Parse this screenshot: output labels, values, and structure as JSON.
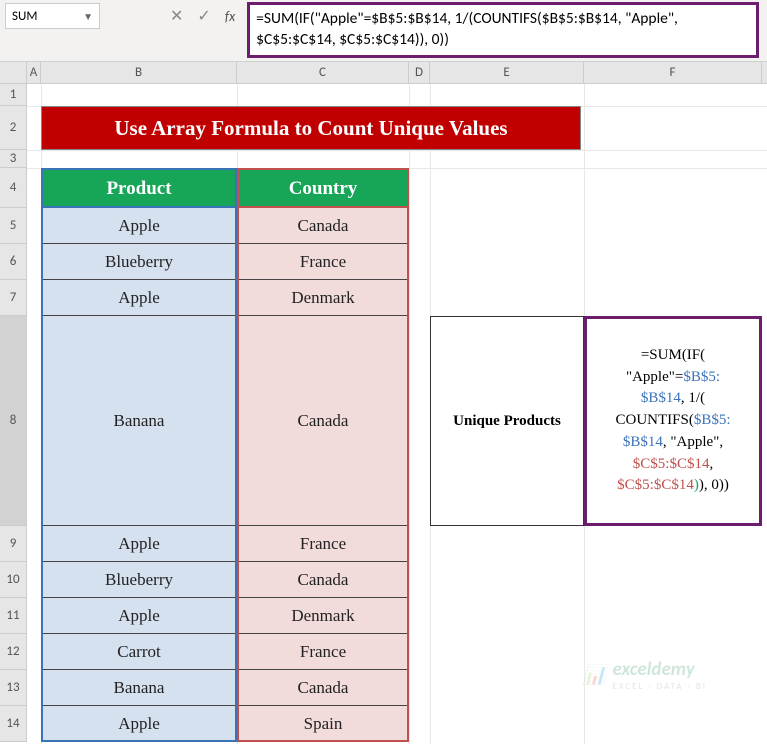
{
  "namebox": {
    "value": "SUM"
  },
  "formula_bar": "=SUM(IF(\"Apple\"=$B$5:$B$14, 1/(COUNTIFS($B$5:$B$14, \"Apple\", $C$5:$C$14, $C$5:$C$14)), 0))",
  "columns": [
    "A",
    "B",
    "C",
    "D",
    "E",
    "F"
  ],
  "rows": [
    "1",
    "2",
    "3",
    "4",
    "5",
    "6",
    "7",
    "8",
    "9",
    "10",
    "11",
    "12",
    "13",
    "14"
  ],
  "title": "Use Array Formula to Count Unique Values",
  "headers": {
    "product": "Product",
    "country": "Country"
  },
  "data": {
    "products": [
      "Apple",
      "Blueberry",
      "Apple",
      "Banana",
      "Apple",
      "Blueberry",
      "Apple",
      "Carrot",
      "Banana",
      "Apple"
    ],
    "countries": [
      "Canada",
      "France",
      "Denmark",
      "Canada",
      "France",
      "Canada",
      "Denmark",
      "France",
      "Canada",
      "Spain"
    ]
  },
  "side": {
    "label": "Unique Products",
    "formula_parts": {
      "p1": "=SUM(IF(",
      "p2": "\"Apple\"=",
      "p3": "$B$5:",
      "p4": "$B$14",
      "p5": ", 1/(",
      "p6": "COUNTIFS(",
      "p7": "$B$5:",
      "p8": "$B$14",
      "p9": ", \"Apple\",",
      "p10": "$C$5:$C$14",
      "p11": ",",
      "p12": "$C$5:$C$14",
      "p13": ")",
      "p14": ")",
      "p15": ", 0)",
      "p16": ")"
    }
  },
  "watermark": {
    "brand": "exceldemy",
    "tag": "EXCEL · DATA · BI"
  },
  "chart_data": {
    "type": "table",
    "title": "Use Array Formula to Count Unique Values",
    "columns": [
      "Product",
      "Country"
    ],
    "rows": [
      [
        "Apple",
        "Canada"
      ],
      [
        "Blueberry",
        "France"
      ],
      [
        "Apple",
        "Denmark"
      ],
      [
        "Banana",
        "Canada"
      ],
      [
        "Apple",
        "France"
      ],
      [
        "Blueberry",
        "Canada"
      ],
      [
        "Apple",
        "Denmark"
      ],
      [
        "Carrot",
        "France"
      ],
      [
        "Banana",
        "Canada"
      ],
      [
        "Apple",
        "Spain"
      ]
    ]
  }
}
